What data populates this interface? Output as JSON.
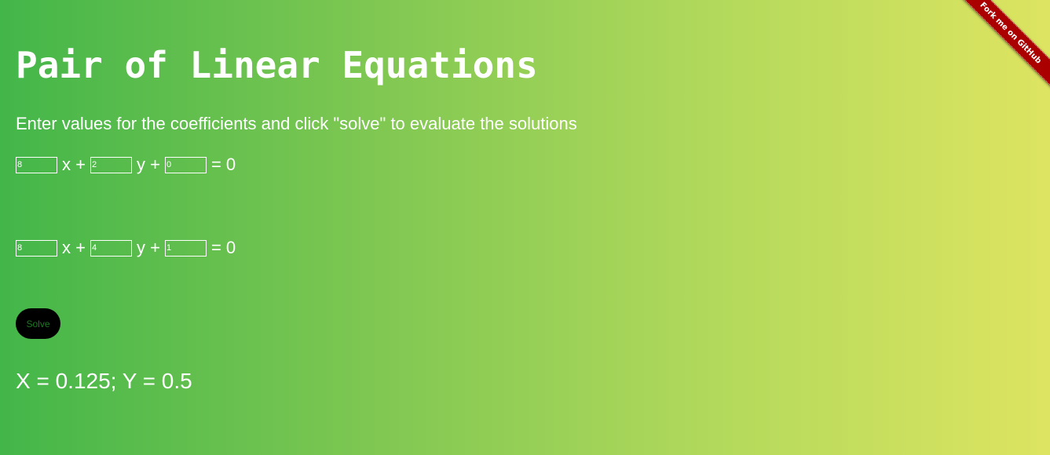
{
  "title": "Pair of Linear Equations",
  "subtitle": "Enter values for the coefficients and click \"solve\" to evaluate the solutions",
  "equations": [
    {
      "a": "8",
      "b": "2",
      "c": "0",
      "x_label": "x +",
      "y_label": "y +",
      "equals_label": "= 0"
    },
    {
      "a": "8",
      "b": "4",
      "c": "1",
      "x_label": "x +",
      "y_label": "y +",
      "equals_label": "= 0"
    }
  ],
  "solve_label": "Solve",
  "result": "X = 0.125; Y = 0.5",
  "ribbon": {
    "label": "Fork me on GitHub",
    "color": "#aa0000"
  },
  "colors": {
    "gradient_start": "#43b649",
    "gradient_end": "#dde461",
    "text": "#ffffff"
  }
}
